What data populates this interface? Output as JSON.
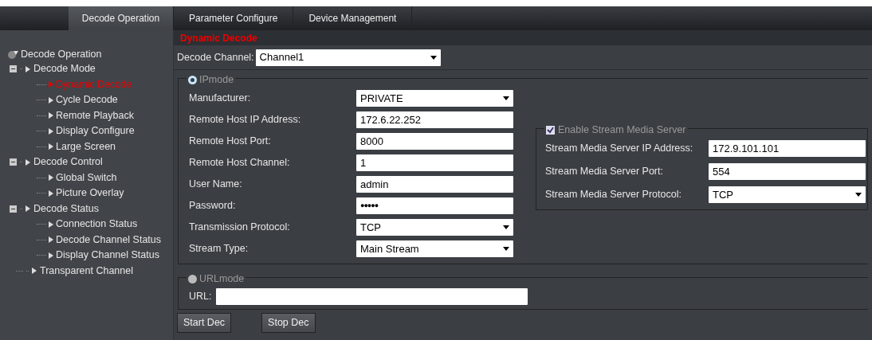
{
  "top_tabs": [
    {
      "label": "Decode Operation",
      "selected": true
    },
    {
      "label": "Parameter Configure",
      "selected": false
    },
    {
      "label": "Device Management",
      "selected": false
    }
  ],
  "sidebar": {
    "root": "Decode Operation",
    "items": [
      {
        "label": "Decode Mode",
        "expanded": true,
        "selected": false,
        "children": [
          {
            "label": "Dynamic Decode",
            "selected": true
          },
          {
            "label": "Cycle Decode",
            "selected": false
          },
          {
            "label": "Remote Playback",
            "selected": false
          },
          {
            "label": "Display Configure",
            "selected": false
          },
          {
            "label": "Large Screen",
            "selected": false
          }
        ]
      },
      {
        "label": "Decode Control",
        "expanded": true,
        "selected": false,
        "children": [
          {
            "label": "Global Switch",
            "selected": false
          },
          {
            "label": "Picture Overlay",
            "selected": false
          }
        ]
      },
      {
        "label": "Decode Status",
        "expanded": true,
        "selected": false,
        "children": [
          {
            "label": "Connection Status",
            "selected": false
          },
          {
            "label": "Decode Channel Status",
            "selected": false
          },
          {
            "label": "Display Channel Status",
            "selected": false
          }
        ]
      },
      {
        "label": "Transparent Channel",
        "selected": false
      }
    ]
  },
  "page_title": "Dynamic Decode",
  "channel": {
    "label": "Decode Channel:",
    "value": "Channel1"
  },
  "ip_mode": {
    "label": "IPmode",
    "selected": true,
    "fields": [
      {
        "label": "Manufacturer:",
        "kind": "select",
        "value": "PRIVATE"
      },
      {
        "label": "Remote Host IP Address:",
        "kind": "text",
        "value": "172.6.22.252"
      },
      {
        "label": "Remote Host Port:",
        "kind": "text",
        "value": "8000"
      },
      {
        "label": "Remote Host Channel:",
        "kind": "text",
        "value": "1"
      },
      {
        "label": "User Name:",
        "kind": "text",
        "value": "admin"
      },
      {
        "label": "Password:",
        "kind": "password",
        "value": "●●●●●"
      },
      {
        "label": "Transmission Protocol:",
        "kind": "select",
        "value": "TCP"
      },
      {
        "label": "Stream Type:",
        "kind": "select",
        "value": "Main Stream"
      }
    ]
  },
  "stream_server": {
    "label": "Enable Stream Media Server",
    "checked": true,
    "fields": [
      {
        "label": "Stream Media Server IP Address:",
        "kind": "text",
        "value": "172.9.101.101"
      },
      {
        "label": "Stream Media Server Port:",
        "kind": "text",
        "value": "554"
      },
      {
        "label": "Stream Media Server Protocol:",
        "kind": "select",
        "value": "TCP"
      }
    ]
  },
  "url_mode": {
    "label": "URLmode",
    "selected": false,
    "url_label": "URL:"
  },
  "buttons": [
    "Start Dec",
    "Stop Dec"
  ]
}
